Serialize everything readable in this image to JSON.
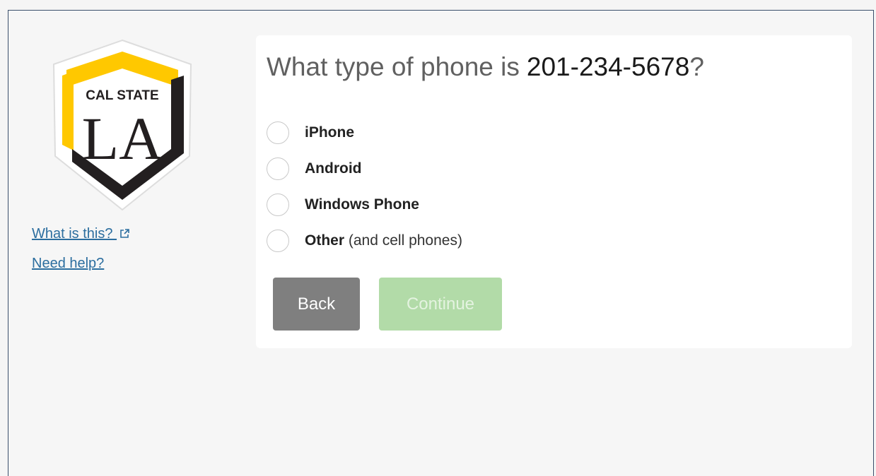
{
  "logo": {
    "line1": "CAL STATE",
    "line2": "LA",
    "colors": {
      "gold": "#ffc800",
      "black": "#231f20"
    }
  },
  "links": {
    "what_is_this": "What is this?",
    "need_help": "Need help?"
  },
  "question": {
    "prefix": "What type of phone is",
    "phone": "201-234-5678",
    "suffix": "?"
  },
  "options": [
    {
      "label": "iPhone",
      "note": ""
    },
    {
      "label": "Android",
      "note": ""
    },
    {
      "label": "Windows Phone",
      "note": ""
    },
    {
      "label": "Other",
      "note": "(and cell phones)"
    }
  ],
  "buttons": {
    "back": "Back",
    "continue": "Continue"
  },
  "colors": {
    "link": "#2c6e9f",
    "back_bg": "#7f7f7f",
    "continue_bg": "#b2dba8"
  }
}
